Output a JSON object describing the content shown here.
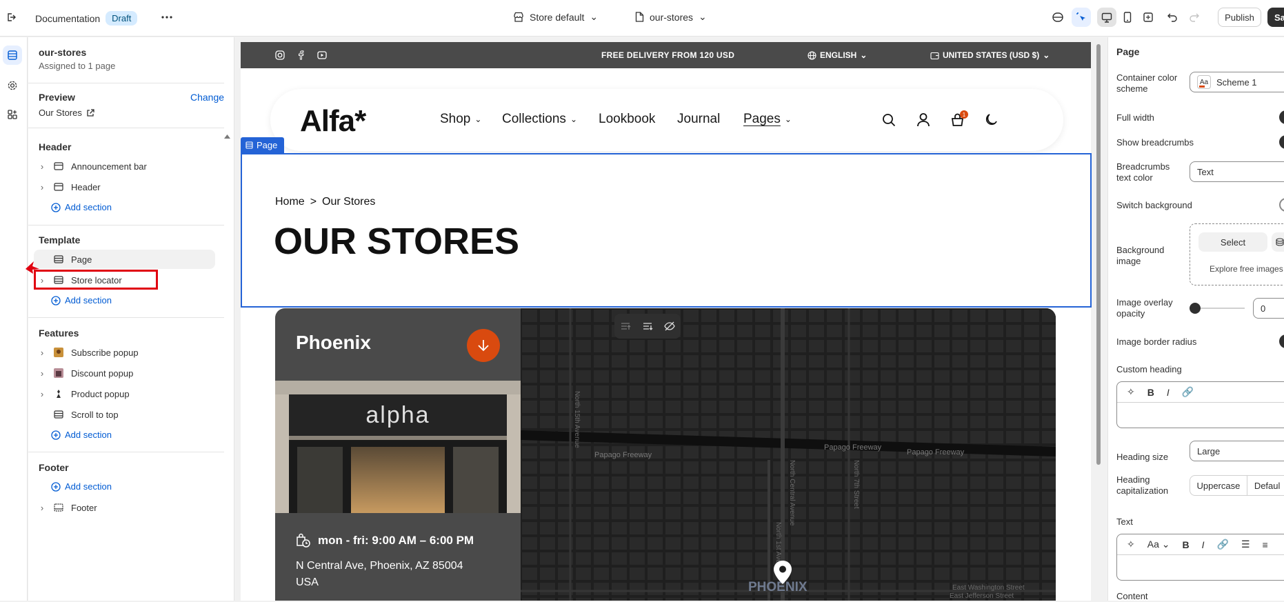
{
  "topbar": {
    "doc_label": "Documentation",
    "status_badge": "Draft",
    "theme_selector": "Store default",
    "template_selector": "our-stores",
    "publish_label": "Publish",
    "save_label": "Sa"
  },
  "sidebar": {
    "template_name": "our-stores",
    "assigned": "Assigned to 1 page",
    "preview_label": "Preview",
    "change_label": "Change",
    "preview_page": "Our Stores",
    "groups": [
      {
        "title": "Header",
        "items": [
          "Announcement bar",
          "Header"
        ],
        "add": "Add section"
      },
      {
        "title": "Template",
        "items": [
          "Page",
          "Store locator"
        ],
        "add": "Add section"
      },
      {
        "title": "Features",
        "items": [
          "Subscribe popup",
          "Discount popup",
          "Product popup",
          "Scroll to top"
        ],
        "add": "Add section"
      },
      {
        "title": "Footer",
        "add": "Add section",
        "items": [
          "Footer"
        ]
      }
    ]
  },
  "preview": {
    "announcement": "FREE DELIVERY FROM 120 USD",
    "language": "ENGLISH",
    "currency": "UNITED STATES (USD $)",
    "logo": "Alfa*",
    "nav": [
      "Shop",
      "Collections",
      "Lookbook",
      "Journal",
      "Pages"
    ],
    "cart_count": "1",
    "page_tag": "Page",
    "breadcrumb_home": "Home",
    "breadcrumb_sep": ">",
    "breadcrumb_current": "Our Stores",
    "page_heading": "OUR STORES",
    "store": {
      "city": "Phoenix",
      "sign": "alpha",
      "hours": "mon - fri: 9:00 AM – 6:00 PM",
      "address_line1": "N Central Ave, Phoenix, AZ 85004",
      "address_line2": "USA"
    },
    "map_labels": {
      "street1": "Papago Freeway",
      "street2": "Papago Freeway",
      "street3": "Papago Freeway",
      "avenue1": "North Central Avenue",
      "avenue2": "North 1st Avenue",
      "avenue3": "North 7th Street",
      "avenue4": "North 15th Avenue",
      "street4": "East Washington Street",
      "street5": "East Jefferson Street",
      "city": "PHOENIX"
    }
  },
  "panel": {
    "title": "Page",
    "container_scheme_label": "Container color scheme",
    "container_scheme_value": "Scheme 1",
    "scheme_swatch": "Aa",
    "full_width": "Full width",
    "show_breadcrumbs": "Show breadcrumbs",
    "breadcrumbs_color_label": "Breadcrumbs text color",
    "breadcrumbs_color_value": "Text",
    "switch_background": "Switch background",
    "background_image": "Background image",
    "select_label": "Select",
    "explore_label": "Explore free images",
    "overlay_label": "Image overlay opacity",
    "overlay_value": "0",
    "border_radius": "Image border radius",
    "custom_heading": "Custom heading",
    "heading_size_label": "Heading size",
    "heading_size_value": "Large",
    "heading_caps_label": "Heading capitalization",
    "caps_uppercase": "Uppercase",
    "caps_default": "Defaul",
    "text_label": "Text",
    "content_label": "Content",
    "rte_aa": "Aa",
    "rte_bold": "B",
    "rte_italic": "I"
  },
  "colors": {
    "accent": "#005bd3",
    "frame": "#2463d6",
    "highlight": "#e00010",
    "store_button": "#d94a0f"
  }
}
